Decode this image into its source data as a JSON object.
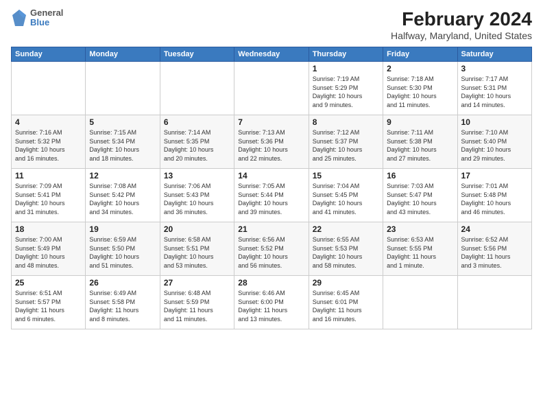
{
  "logo": {
    "general": "General",
    "blue": "Blue"
  },
  "title": "February 2024",
  "subtitle": "Halfway, Maryland, United States",
  "days_of_week": [
    "Sunday",
    "Monday",
    "Tuesday",
    "Wednesday",
    "Thursday",
    "Friday",
    "Saturday"
  ],
  "weeks": [
    [
      {
        "day": "",
        "info": ""
      },
      {
        "day": "",
        "info": ""
      },
      {
        "day": "",
        "info": ""
      },
      {
        "day": "",
        "info": ""
      },
      {
        "day": "1",
        "info": "Sunrise: 7:19 AM\nSunset: 5:29 PM\nDaylight: 10 hours\nand 9 minutes."
      },
      {
        "day": "2",
        "info": "Sunrise: 7:18 AM\nSunset: 5:30 PM\nDaylight: 10 hours\nand 11 minutes."
      },
      {
        "day": "3",
        "info": "Sunrise: 7:17 AM\nSunset: 5:31 PM\nDaylight: 10 hours\nand 14 minutes."
      }
    ],
    [
      {
        "day": "4",
        "info": "Sunrise: 7:16 AM\nSunset: 5:32 PM\nDaylight: 10 hours\nand 16 minutes."
      },
      {
        "day": "5",
        "info": "Sunrise: 7:15 AM\nSunset: 5:34 PM\nDaylight: 10 hours\nand 18 minutes."
      },
      {
        "day": "6",
        "info": "Sunrise: 7:14 AM\nSunset: 5:35 PM\nDaylight: 10 hours\nand 20 minutes."
      },
      {
        "day": "7",
        "info": "Sunrise: 7:13 AM\nSunset: 5:36 PM\nDaylight: 10 hours\nand 22 minutes."
      },
      {
        "day": "8",
        "info": "Sunrise: 7:12 AM\nSunset: 5:37 PM\nDaylight: 10 hours\nand 25 minutes."
      },
      {
        "day": "9",
        "info": "Sunrise: 7:11 AM\nSunset: 5:38 PM\nDaylight: 10 hours\nand 27 minutes."
      },
      {
        "day": "10",
        "info": "Sunrise: 7:10 AM\nSunset: 5:40 PM\nDaylight: 10 hours\nand 29 minutes."
      }
    ],
    [
      {
        "day": "11",
        "info": "Sunrise: 7:09 AM\nSunset: 5:41 PM\nDaylight: 10 hours\nand 31 minutes."
      },
      {
        "day": "12",
        "info": "Sunrise: 7:08 AM\nSunset: 5:42 PM\nDaylight: 10 hours\nand 34 minutes."
      },
      {
        "day": "13",
        "info": "Sunrise: 7:06 AM\nSunset: 5:43 PM\nDaylight: 10 hours\nand 36 minutes."
      },
      {
        "day": "14",
        "info": "Sunrise: 7:05 AM\nSunset: 5:44 PM\nDaylight: 10 hours\nand 39 minutes."
      },
      {
        "day": "15",
        "info": "Sunrise: 7:04 AM\nSunset: 5:45 PM\nDaylight: 10 hours\nand 41 minutes."
      },
      {
        "day": "16",
        "info": "Sunrise: 7:03 AM\nSunset: 5:47 PM\nDaylight: 10 hours\nand 43 minutes."
      },
      {
        "day": "17",
        "info": "Sunrise: 7:01 AM\nSunset: 5:48 PM\nDaylight: 10 hours\nand 46 minutes."
      }
    ],
    [
      {
        "day": "18",
        "info": "Sunrise: 7:00 AM\nSunset: 5:49 PM\nDaylight: 10 hours\nand 48 minutes."
      },
      {
        "day": "19",
        "info": "Sunrise: 6:59 AM\nSunset: 5:50 PM\nDaylight: 10 hours\nand 51 minutes."
      },
      {
        "day": "20",
        "info": "Sunrise: 6:58 AM\nSunset: 5:51 PM\nDaylight: 10 hours\nand 53 minutes."
      },
      {
        "day": "21",
        "info": "Sunrise: 6:56 AM\nSunset: 5:52 PM\nDaylight: 10 hours\nand 56 minutes."
      },
      {
        "day": "22",
        "info": "Sunrise: 6:55 AM\nSunset: 5:53 PM\nDaylight: 10 hours\nand 58 minutes."
      },
      {
        "day": "23",
        "info": "Sunrise: 6:53 AM\nSunset: 5:55 PM\nDaylight: 11 hours\nand 1 minute."
      },
      {
        "day": "24",
        "info": "Sunrise: 6:52 AM\nSunset: 5:56 PM\nDaylight: 11 hours\nand 3 minutes."
      }
    ],
    [
      {
        "day": "25",
        "info": "Sunrise: 6:51 AM\nSunset: 5:57 PM\nDaylight: 11 hours\nand 6 minutes."
      },
      {
        "day": "26",
        "info": "Sunrise: 6:49 AM\nSunset: 5:58 PM\nDaylight: 11 hours\nand 8 minutes."
      },
      {
        "day": "27",
        "info": "Sunrise: 6:48 AM\nSunset: 5:59 PM\nDaylight: 11 hours\nand 11 minutes."
      },
      {
        "day": "28",
        "info": "Sunrise: 6:46 AM\nSunset: 6:00 PM\nDaylight: 11 hours\nand 13 minutes."
      },
      {
        "day": "29",
        "info": "Sunrise: 6:45 AM\nSunset: 6:01 PM\nDaylight: 11 hours\nand 16 minutes."
      },
      {
        "day": "",
        "info": ""
      },
      {
        "day": "",
        "info": ""
      }
    ]
  ]
}
